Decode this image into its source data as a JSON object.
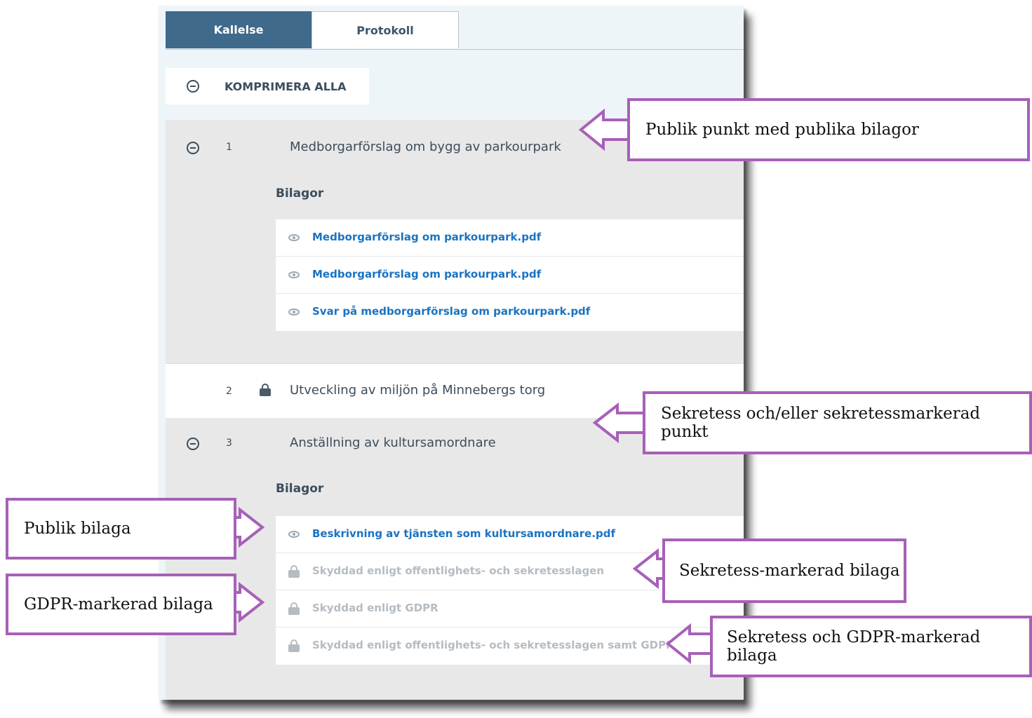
{
  "tabs": [
    {
      "label": "Kallelse",
      "active": true
    },
    {
      "label": "Protokoll",
      "active": false
    }
  ],
  "collapse_all": {
    "label": "KOMPRIMERA ALLA",
    "icon": "minus-circle-icon"
  },
  "agenda": {
    "item1": {
      "number": "1",
      "title": "Medborgarförslag om bygg av parkourpark",
      "attachments_label": "Bilagor",
      "attachments": [
        "Medborgarförslag om parkourpark.pdf",
        "Medborgarförslag om parkourpark.pdf",
        "Svar på medborgarförslag om parkourpark.pdf"
      ]
    },
    "item2": {
      "number": "2",
      "title": "Utveckling av miljön på Minnebergs torg",
      "icon": "lock-icon"
    },
    "item3": {
      "number": "3",
      "title": "Anställning av kultursamordnare",
      "attachments_label": "Bilagor",
      "attachments": [
        "Beskrivning av tjänsten som kultursamordnare.pdf",
        "Skyddad enligt offentlighets- och sekretesslagen",
        "Skyddad enligt GDPR",
        "Skyddad enligt offentlighets- och sekretesslagen samt GDPR"
      ]
    }
  },
  "callouts": {
    "public_item": "Publik punkt med publika bilagor",
    "secret_item": "Sekretess och/eller sekretessmarkerad punkt",
    "public_attachment": "Publik bilaga",
    "secret_attachment": "Sekretess-markerad bilaga",
    "gdpr_attachment": "GDPR-markerad bilaga",
    "secret_gdpr_attachment": "Sekretess och GDPR-markerad bilaga"
  },
  "colors": {
    "active_tab": "#3f6a8c",
    "link": "#1b73c2",
    "callout_border": "#a760b8",
    "protected_text": "#b5bcc2"
  }
}
